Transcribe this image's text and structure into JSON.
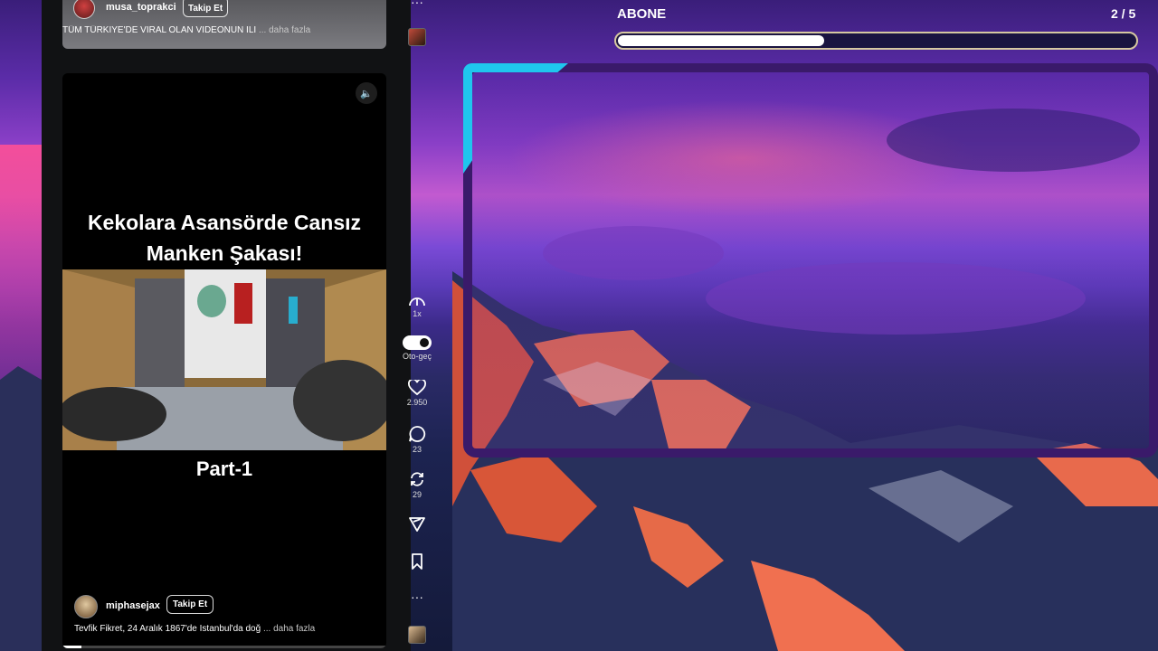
{
  "top_post": {
    "username": "musa_toprakci",
    "follow_label": "Takip Et",
    "caption": "TÜM TÜRKİYE'DE VİRAL OLAN VİDEONUN İLİ",
    "more_label": "... daha fazla"
  },
  "main_post": {
    "video_title_line1": "Kekolara Asansörde Cansız",
    "video_title_line2": "Manken Şakası!",
    "part_label": "Part-1",
    "username": "miphasejax",
    "follow_label": "Takip Et",
    "caption": "Tevfik Fikret, 24 Aralık 1867'de İstanbul'da doğ",
    "more_label": "... daha fazla",
    "sound_icon": "speaker-icon",
    "playback_progress_percent": 6
  },
  "rail": {
    "more_top": "···",
    "speed_label": "1x",
    "autoplay_label": "Oto-geç",
    "autoplay_on": true,
    "likes": "2.950",
    "comments": "23",
    "reposts": "29",
    "more_bottom": "···"
  },
  "overlay": {
    "goal_label": "ABONE",
    "goal_count": "2 / 5",
    "goal_fraction": 0.4,
    "accent_color": "#1fc6ee",
    "frame_color": "#3a1a6a"
  }
}
